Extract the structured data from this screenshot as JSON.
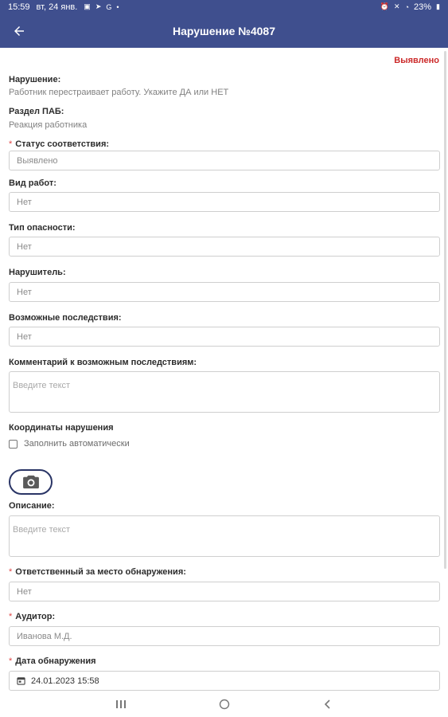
{
  "statusbar": {
    "time": "15:59",
    "date": "вт, 24 янв.",
    "battery": "23%"
  },
  "header": {
    "title": "Нарушение №4087",
    "back_icon": "arrow-left-icon"
  },
  "status_badge": "Выявлено",
  "violation": {
    "label": "Нарушение:",
    "value": "Работник перестраивает работу. Укажите ДА или НЕТ"
  },
  "pab_section": {
    "label": "Раздел ПАБ:",
    "value": "Реакция работника"
  },
  "form": {
    "compliance_status": {
      "label": "Статус соответствия:",
      "value": "Выявлено",
      "required": true
    },
    "work_type": {
      "label": "Вид работ:",
      "value": "Нет"
    },
    "hazard_type": {
      "label": "Тип опасности:",
      "value": "Нет"
    },
    "violator": {
      "label": "Нарушитель:",
      "value": "Нет"
    },
    "consequences": {
      "label": "Возможные последствия:",
      "value": "Нет"
    },
    "consequences_comment": {
      "label": "Комментарий к возможным последствиям:",
      "placeholder": "Введите текст"
    },
    "coordinates": {
      "label": "Координаты нарушения",
      "auto_fill_label": "Заполнить автоматически"
    },
    "description": {
      "label": "Описание:",
      "placeholder": "Введите текст"
    },
    "responsible": {
      "label": "Ответственный за место обнаружения:",
      "value": "Нет",
      "required": true
    },
    "auditor": {
      "label": "Аудитор:",
      "value": "Иванова М.Д.",
      "required": true
    },
    "detection_date": {
      "label": "Дата обнаружения",
      "value": "24.01.2023  15:58",
      "required": true
    }
  },
  "colors": {
    "header_bg": "#3f4f8e",
    "status_red": "#cc2a2a",
    "required_star": "#e04646"
  }
}
